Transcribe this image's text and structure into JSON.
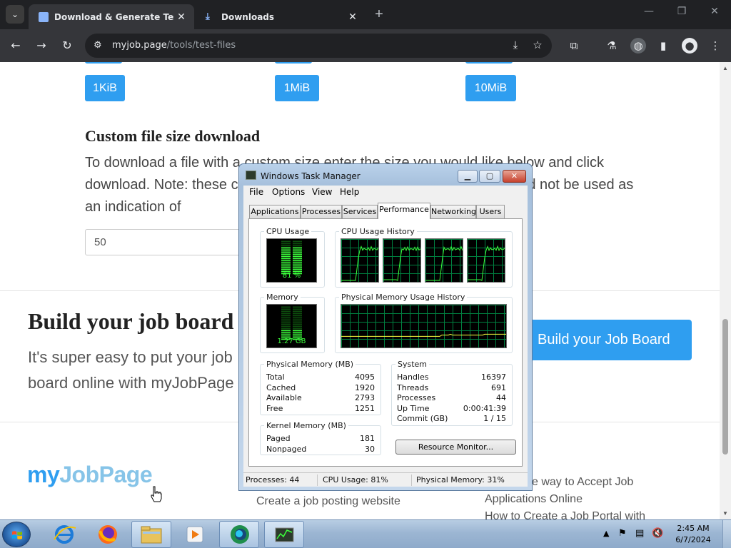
{
  "browser": {
    "tabs": [
      {
        "title": "Download & Generate Test Fil",
        "close": "✕"
      },
      {
        "title": "Downloads",
        "close": "✕"
      }
    ],
    "new_tab": "+",
    "window_controls": [
      "—",
      "❐",
      "✕"
    ],
    "url_host": "myjob.page",
    "url_path": "/tools/test-files",
    "accent_color": "#2f9ef0"
  },
  "page": {
    "size_buttons": [
      "1KiB",
      "1MiB",
      "10MiB"
    ],
    "custom_heading": "Custom file size download",
    "custom_description": "To download a file with a custom size enter the size you would like below and click download. Note: these custom files are randomly generated and should not be used as an indication of",
    "size_input_value": "50",
    "build_title": "Build your job board",
    "build_description": "It's super easy to put your job board online with myJobPage",
    "build_button": "Build your Job Board",
    "logo_part1": "my",
    "logo_part2": "JobPage",
    "footer_link_1": "Create a job posting website",
    "footer_link_2": "e way to Accept Job",
    "footer_link_3": "Applications Online",
    "footer_link_4": "How to Create a Job Portal with"
  },
  "task_manager": {
    "title": "Windows Task Manager",
    "caption_buttons": [
      "▁",
      "▢",
      "✕"
    ],
    "menu": [
      "File",
      "Options",
      "View",
      "Help"
    ],
    "tabs": [
      "Applications",
      "Processes",
      "Services",
      "Performance",
      "Networking",
      "Users"
    ],
    "active_tab": "Performance",
    "cpu_usage_label": "CPU Usage",
    "cpu_usage_value": "81 %",
    "cpu_usage_fraction": 0.81,
    "cpu_history_label": "CPU Usage History",
    "memory_label": "Memory",
    "memory_value": "1.27 GB",
    "memory_fraction": 0.31,
    "memory_history_label": "Physical Memory Usage History",
    "physical_memory": {
      "label": "Physical Memory (MB)",
      "rows": [
        {
          "key": "Total",
          "value": "4095"
        },
        {
          "key": "Cached",
          "value": "1920"
        },
        {
          "key": "Available",
          "value": "2793"
        },
        {
          "key": "Free",
          "value": "1251"
        }
      ]
    },
    "system": {
      "label": "System",
      "rows": [
        {
          "key": "Handles",
          "value": "16397"
        },
        {
          "key": "Threads",
          "value": "691"
        },
        {
          "key": "Processes",
          "value": "44"
        },
        {
          "key": "Up Time",
          "value": "0:00:41:39"
        },
        {
          "key": "Commit (GB)",
          "value": "1 / 15"
        }
      ]
    },
    "kernel_memory": {
      "label": "Kernel Memory (MB)",
      "rows": [
        {
          "key": "Paged",
          "value": "181"
        },
        {
          "key": "Nonpaged",
          "value": "30"
        }
      ]
    },
    "resource_monitor_button": "Resource Monitor...",
    "status": {
      "processes": "Processes: 44",
      "cpu": "CPU Usage: 81%",
      "memory": "Physical Memory: 31%"
    },
    "graph_color": "#3cff3c",
    "grid_color": "#008040"
  },
  "taskbar": {
    "apps": [
      "internet-explorer",
      "firefox",
      "file-explorer",
      "media-player",
      "browser",
      "task-manager"
    ],
    "clock_time": "2:45 AM",
    "clock_date": "6/7/2024"
  }
}
